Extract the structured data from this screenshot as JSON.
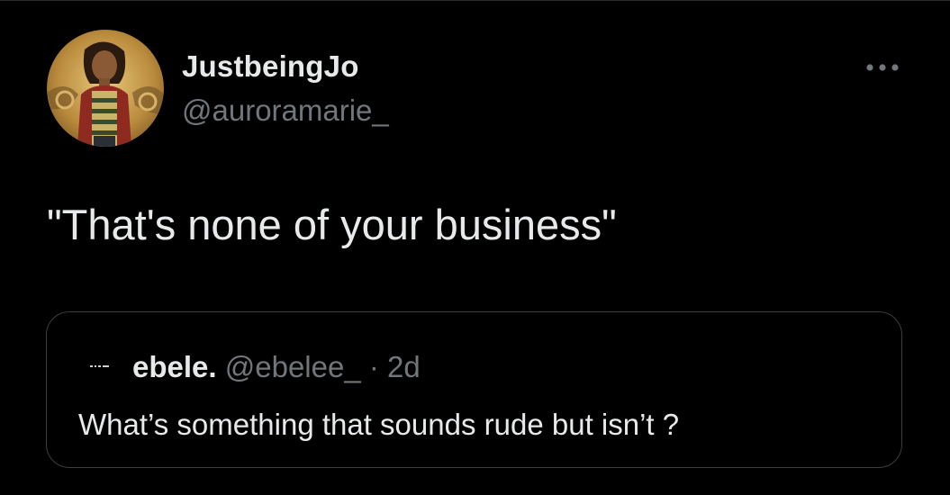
{
  "tweet": {
    "author": {
      "name": "JustbeingJo",
      "handle": "@auroramarie_"
    },
    "text": "\"That's none of your business\"",
    "more_icon": "more-horizontal-icon"
  },
  "quote": {
    "author": {
      "name": "ebele.",
      "handle": "@ebelee_",
      "separator": " · ",
      "time": "2d"
    },
    "text": "What’s something that sounds rude but isn’t ?"
  },
  "colors": {
    "background": "#000000",
    "text_primary": "#e7e9ea",
    "text_secondary": "#71767b",
    "border": "#3a3d41"
  }
}
